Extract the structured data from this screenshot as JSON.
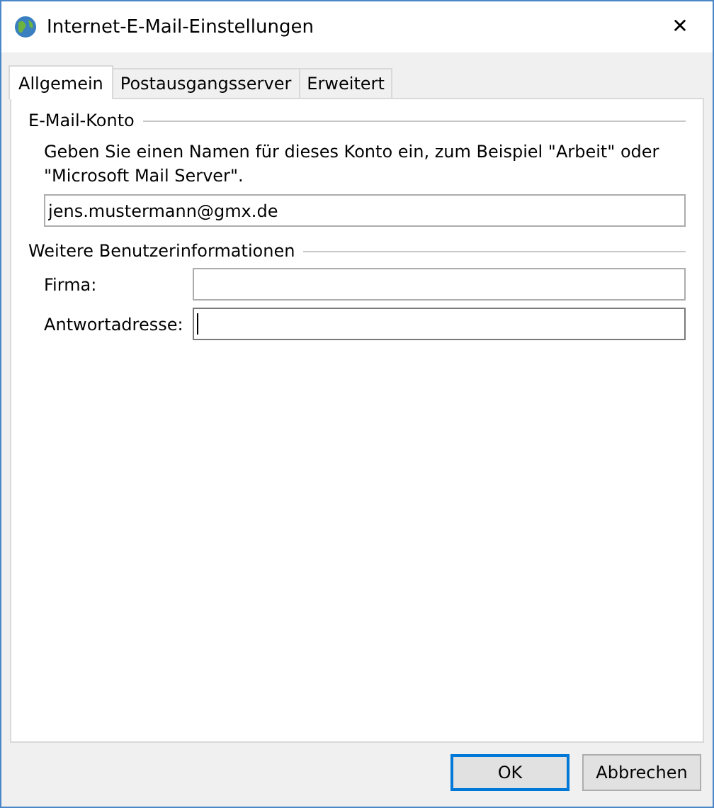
{
  "window": {
    "title": "Internet-E-Mail-Einstellungen",
    "close": "✕"
  },
  "tabs": [
    {
      "label": "Allgemein",
      "selected": true
    },
    {
      "label": "Postausgangsserver",
      "selected": false
    },
    {
      "label": "Erweitert",
      "selected": false
    }
  ],
  "account_group": {
    "title": "E-Mail-Konto",
    "description": "Geben Sie einen Namen für dieses Konto ein, zum Beispiel \"Arbeit\" oder \"Microsoft Mail Server\".",
    "value": "jens.mustermann@gmx.de"
  },
  "user_group": {
    "title": "Weitere Benutzerinformationen",
    "fields": [
      {
        "label": "Firma:",
        "focused": false
      },
      {
        "label": "Antwortadresse:",
        "focused": true
      }
    ]
  },
  "buttons": [
    {
      "label": "OK",
      "default": true
    },
    {
      "label": "Abbrechen",
      "default": false
    }
  ]
}
